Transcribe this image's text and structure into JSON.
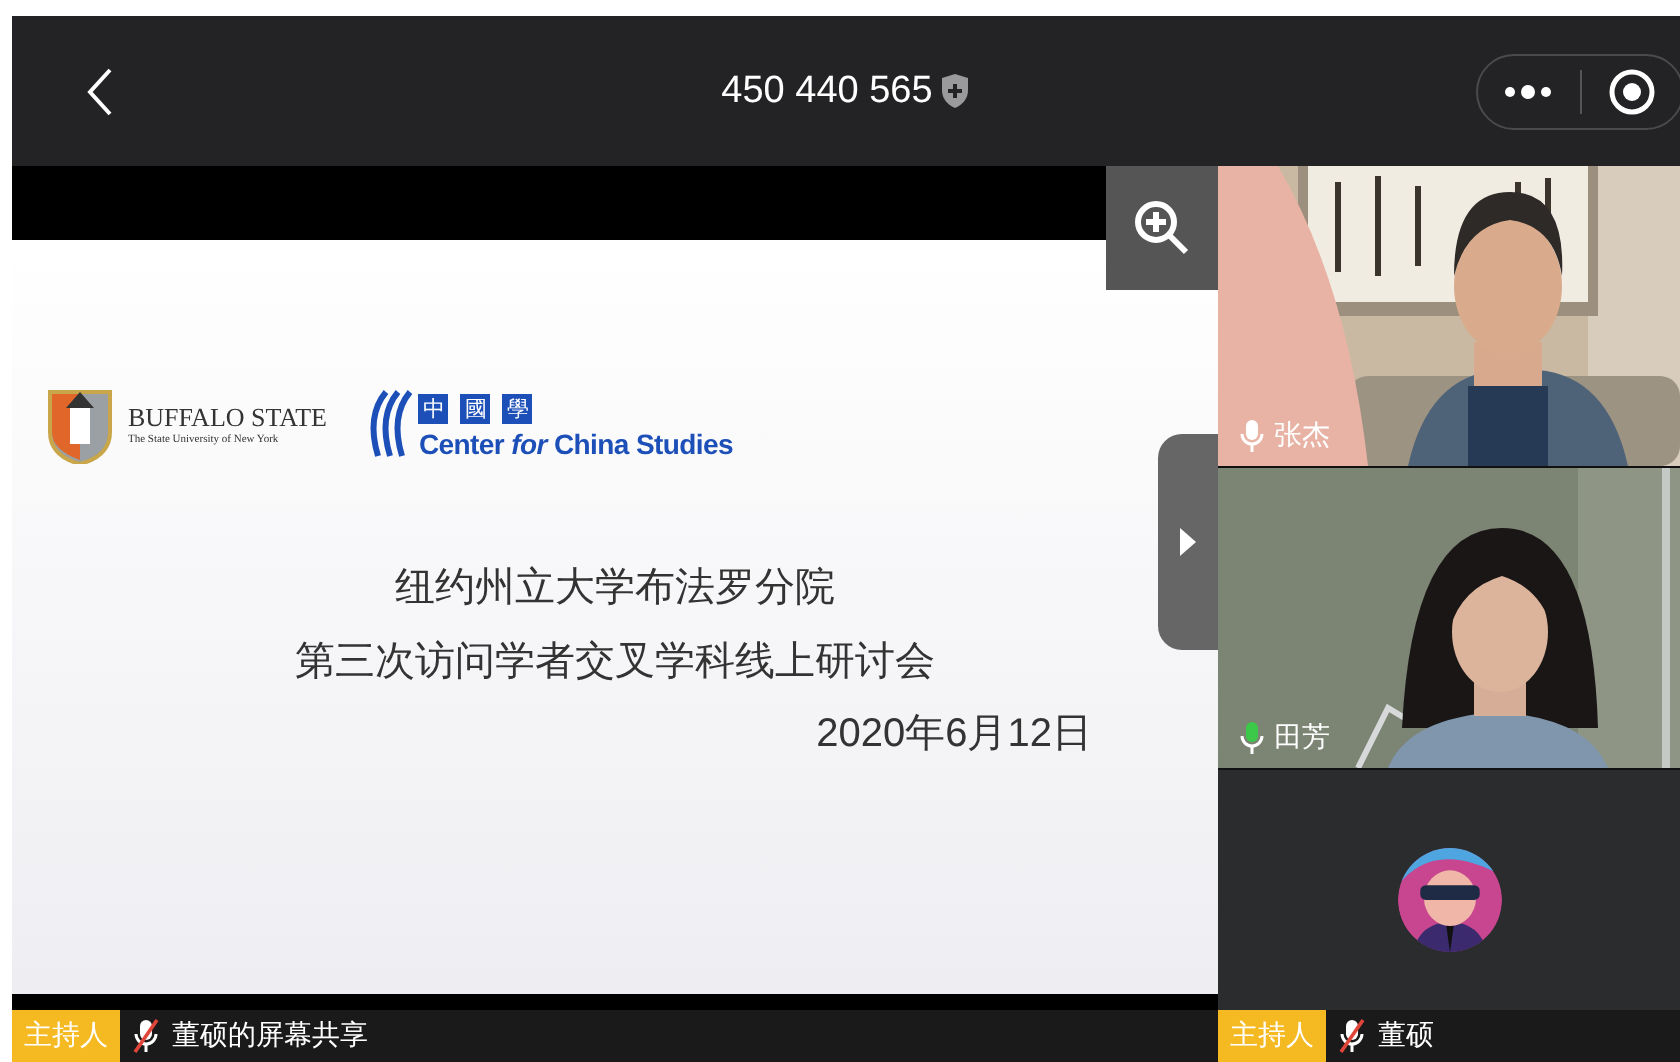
{
  "top_bar": {
    "meeting_id": "450 440 565"
  },
  "slide": {
    "logos": [
      {
        "kind": "seal",
        "title": "BUFFALO STATE",
        "subtitle": "The State University of New York"
      },
      {
        "kind": "wave",
        "characters": [
          "中",
          "國",
          "學"
        ],
        "name": "Center *for* China Studies"
      }
    ],
    "lines": [
      {
        "kind": "title",
        "text": "纽约州立大学布法罗分院"
      },
      {
        "kind": "title",
        "text": "第三次访问学者交叉学科线上研讨会"
      },
      {
        "kind": "date",
        "text": "2020年6月12日"
      }
    ]
  },
  "share_bar": {
    "role": "主持人",
    "muted": true,
    "label": "董硕的屏幕共享"
  },
  "participants": [
    {
      "kind": "video",
      "name": "张杰",
      "muted": false,
      "speaking": false
    },
    {
      "kind": "video",
      "name": "田芳",
      "muted": false,
      "speaking": true
    },
    {
      "kind": "avatar",
      "role": "主持人",
      "name": "董硕",
      "muted": true,
      "speaking": false
    }
  ]
}
